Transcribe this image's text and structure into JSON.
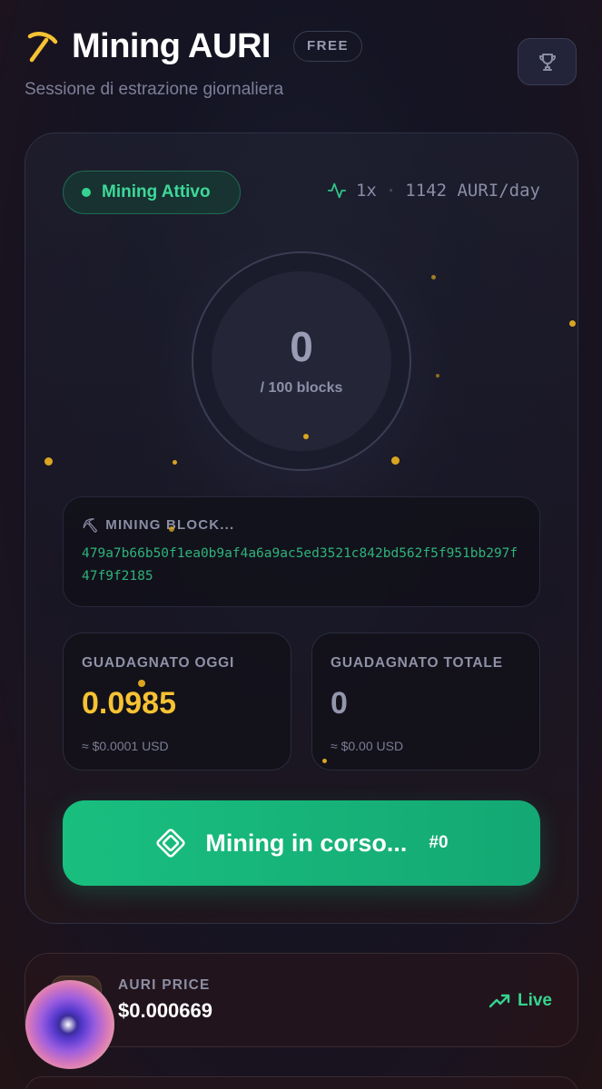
{
  "header": {
    "title": "Mining AURI",
    "plan_badge": "FREE",
    "subtitle": "Sessione di estrazione giornaliera"
  },
  "status": {
    "label": "Mining Attivo",
    "multiplier": "1x",
    "rate": "1142 AURI/day"
  },
  "progress": {
    "blocks_mined": "0",
    "blocks_total_label": "/ 100 blocks"
  },
  "mining_block": {
    "label": "MINING BLOCK...",
    "hash": "479a7b66b50f1ea0b9af4a6a9ac5ed3521c842bd562f5f951bb297f47f9f2185"
  },
  "stats": {
    "today": {
      "label": "GUADAGNATO OGGI",
      "value": "0.0985",
      "usd": "≈ $0.0001 USD"
    },
    "total": {
      "label": "GUADAGNATO TOTALE",
      "value": "0",
      "usd": "≈ $0.00 USD"
    }
  },
  "mine_button": {
    "label": "Mining in corso...",
    "counter": "#0"
  },
  "price": {
    "label": "AURI PRICE",
    "value": "$0.000669",
    "live_label": "Live"
  },
  "colors": {
    "accent_green": "#1cc283",
    "gold": "#f5c233",
    "hash_green": "#2fb27a"
  },
  "icons": [
    "pickaxe-icon",
    "trophy-icon",
    "activity-icon",
    "cpu-icon",
    "trending-up-icon"
  ]
}
